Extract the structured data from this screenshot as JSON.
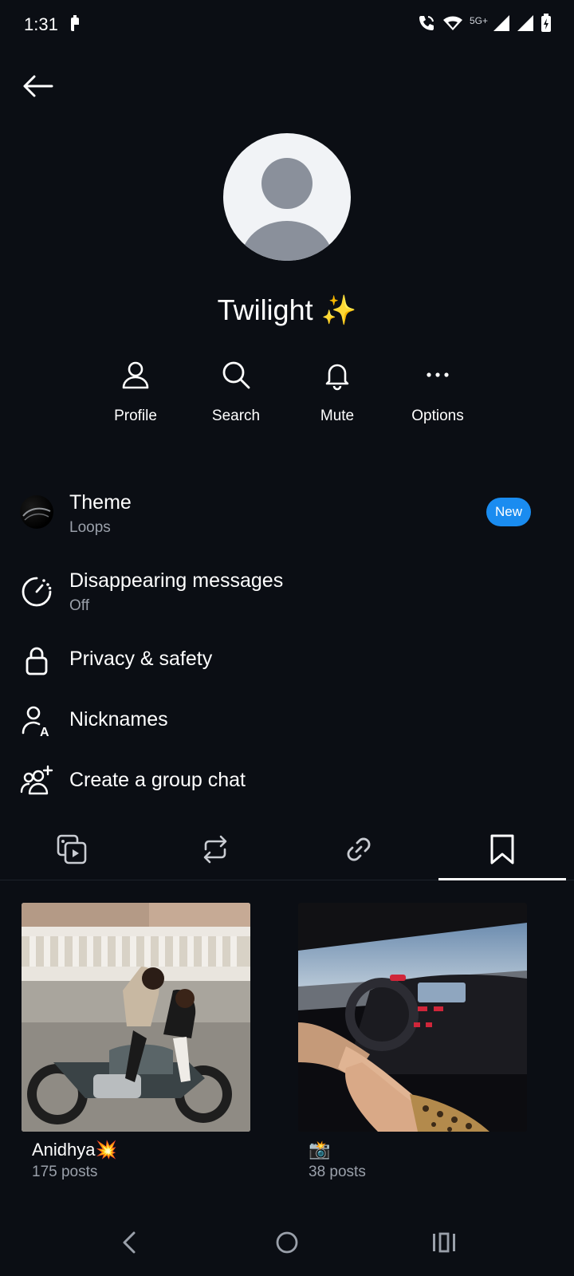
{
  "status_bar": {
    "time": "1:31",
    "network_label": "5G+"
  },
  "header": {
    "back_icon": "arrow-left-icon"
  },
  "chat": {
    "title": "Twilight ✨"
  },
  "actions": [
    {
      "label": "Profile",
      "icon": "person-icon"
    },
    {
      "label": "Search",
      "icon": "search-icon"
    },
    {
      "label": "Mute",
      "icon": "bell-icon"
    },
    {
      "label": "Options",
      "icon": "more-icon"
    }
  ],
  "settings": {
    "theme": {
      "title": "Theme",
      "subtitle": "Loops",
      "badge": "New"
    },
    "disappearing": {
      "title": "Disappearing messages",
      "subtitle": "Off"
    },
    "privacy": {
      "title": "Privacy & safety"
    },
    "nicknames": {
      "title": "Nicknames"
    },
    "group": {
      "title": "Create a group chat"
    }
  },
  "tabs": [
    {
      "icon": "media-icon",
      "active": false
    },
    {
      "icon": "repost-icon",
      "active": false
    },
    {
      "icon": "link-icon",
      "active": false
    },
    {
      "icon": "bookmark-icon",
      "active": true
    }
  ],
  "saved": [
    {
      "name": "Anidhya💥",
      "count": "175 posts"
    },
    {
      "name": "📸",
      "count": "38 posts"
    }
  ],
  "colors": {
    "background": "#0b0e14",
    "accent": "#1a8cf0",
    "secondary_text": "#9aa0aa"
  }
}
